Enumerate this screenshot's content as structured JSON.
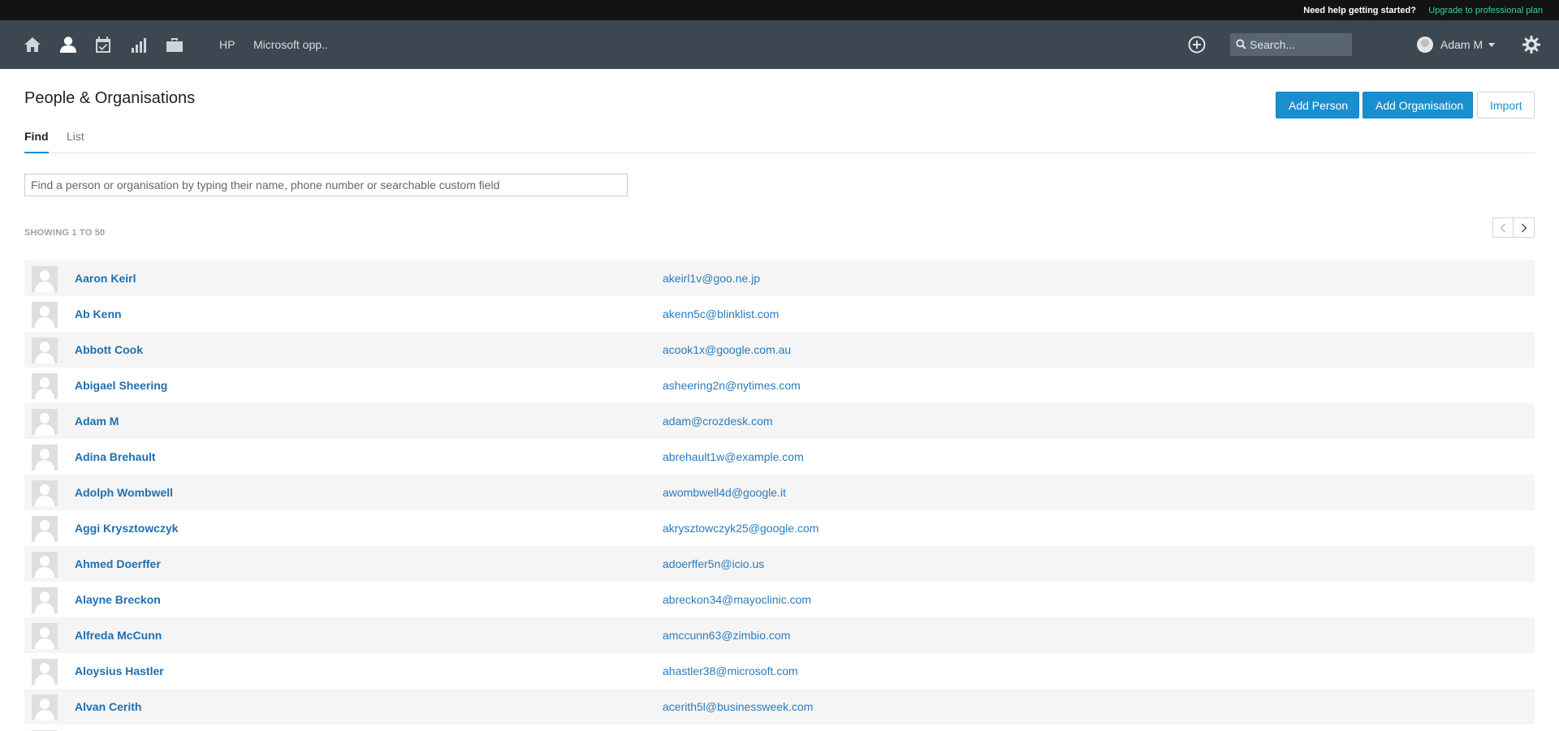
{
  "topbar": {
    "help_text": "Need help getting started?",
    "upgrade_link": "Upgrade to professional plan",
    "upgrade_color": "#3ecf8e"
  },
  "nav": {
    "icons": [
      "home-icon",
      "person-icon",
      "calendar-check-icon",
      "bar-chart-icon",
      "briefcase-icon"
    ],
    "active_icon": "person-icon",
    "links": [
      "HP",
      "Microsoft opp.."
    ],
    "search_placeholder": "Search...",
    "user_name": "Adam M"
  },
  "page": {
    "title": "People & Organisations",
    "buttons": {
      "add_person": "Add Person",
      "add_organisation": "Add Organisation",
      "import": "Import"
    },
    "tabs": [
      {
        "label": "Find",
        "active": true
      },
      {
        "label": "List",
        "active": false
      }
    ],
    "find_placeholder": "Find a person or organisation by typing their name, phone number or searchable custom field",
    "showing": "SHOWING 1 TO 50"
  },
  "people": [
    {
      "name": "Aaron Keirl",
      "email": "akeirl1v@goo.ne.jp"
    },
    {
      "name": "Ab Kenn",
      "email": "akenn5c@blinklist.com"
    },
    {
      "name": "Abbott Cook",
      "email": "acook1x@google.com.au"
    },
    {
      "name": "Abigael Sheering",
      "email": "asheering2n@nytimes.com"
    },
    {
      "name": "Adam M",
      "email": "adam@crozdesk.com"
    },
    {
      "name": "Adina Brehault",
      "email": "abrehault1w@example.com"
    },
    {
      "name": "Adolph Wombwell",
      "email": "awombwell4d@google.it"
    },
    {
      "name": "Aggi Krysztowczyk",
      "email": "akrysztowczyk25@google.com"
    },
    {
      "name": "Ahmed Doerffer",
      "email": "adoerffer5n@icio.us"
    },
    {
      "name": "Alayne Breckon",
      "email": "abreckon34@mayoclinic.com"
    },
    {
      "name": "Alfreda McCunn",
      "email": "amccunn63@zimbio.com"
    },
    {
      "name": "Aloysius Hastler",
      "email": "ahastler38@microsoft.com"
    },
    {
      "name": "Alvan Cerith",
      "email": "acerith5l@businessweek.com"
    },
    {
      "name": "",
      "email": ""
    }
  ],
  "colors": {
    "accent": "#1a8fcf",
    "navbar": "#3c4751",
    "topstrip": "#131313",
    "link": "#1f6faf"
  }
}
